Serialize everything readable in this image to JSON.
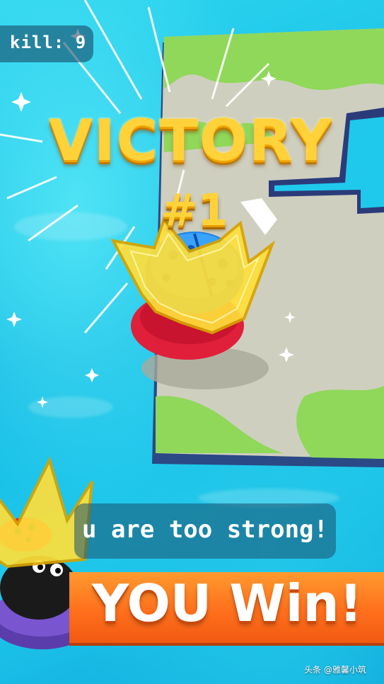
{
  "hud": {
    "kill_label": "kill: 9"
  },
  "result": {
    "title": "VICTORY",
    "rank": "#1",
    "message": "u are too strong!",
    "win_label": "YOU Win!"
  },
  "watermark": "头条 @雅馨小筑",
  "colors": {
    "water": "#1fc9ec",
    "victory_gold": "#ffd23a",
    "win_orange": "#ff6f1c",
    "island_grass": "#8fd85a",
    "island_ground": "#cfcfbf"
  },
  "icons": [
    "ladybug-player-icon",
    "gold-crown-icon",
    "ladybug-opponent-icon",
    "sparkle-icon"
  ]
}
